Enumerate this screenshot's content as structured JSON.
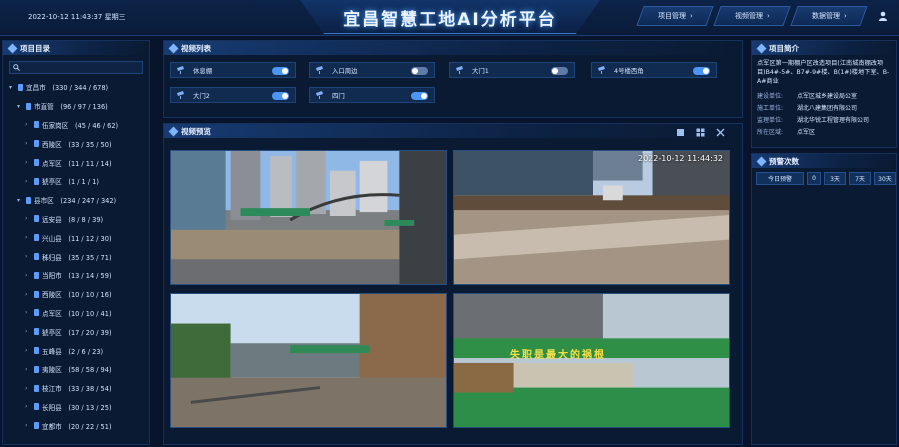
{
  "header": {
    "datetime": "2022-10-12 11:43:37 星期三",
    "title": "宜昌智慧工地AI分析平台",
    "nav": [
      "项目管理",
      "视频管理",
      "数据管理"
    ]
  },
  "left_panel": {
    "title": "项目目录",
    "tree": [
      {
        "label": "宜昌市　(330 / 344 / 678)",
        "level": 0,
        "arrow": "▾"
      },
      {
        "label": "市直管　(96 / 97 / 136)",
        "level": 1,
        "arrow": "▾"
      },
      {
        "label": "伍家岗区　(45 / 46 / 62)",
        "level": 2,
        "arrow": "›"
      },
      {
        "label": "西陵区　(33 / 35 / 50)",
        "level": 2,
        "arrow": "›"
      },
      {
        "label": "点军区　(11 / 11 / 14)",
        "level": 2,
        "arrow": "›"
      },
      {
        "label": "猇亭区　(1 / 1 / 1)",
        "level": 2,
        "arrow": "›"
      },
      {
        "label": "县市区　(234 / 247 / 342)",
        "level": 1,
        "arrow": "▾"
      },
      {
        "label": "远安县　(8 / 8 / 39)",
        "level": 2,
        "arrow": "›"
      },
      {
        "label": "兴山县　(11 / 12 / 30)",
        "level": 2,
        "arrow": "›"
      },
      {
        "label": "秭归县　(35 / 35 / 71)",
        "level": 2,
        "arrow": "›"
      },
      {
        "label": "当阳市　(13 / 14 / 59)",
        "level": 2,
        "arrow": "›"
      },
      {
        "label": "西陵区　(10 / 10 / 16)",
        "level": 2,
        "arrow": "›"
      },
      {
        "label": "点军区　(10 / 10 / 41)",
        "level": 2,
        "arrow": "›"
      },
      {
        "label": "猇亭区　(17 / 20 / 39)",
        "level": 2,
        "arrow": "›"
      },
      {
        "label": "五峰县　(2 / 6 / 23)",
        "level": 2,
        "arrow": "›"
      },
      {
        "label": "夷陵区　(58 / 58 / 94)",
        "level": 2,
        "arrow": "›"
      },
      {
        "label": "枝江市　(33 / 38 / 54)",
        "level": 2,
        "arrow": "›"
      },
      {
        "label": "长阳县　(30 / 13 / 25)",
        "level": 2,
        "arrow": "›"
      },
      {
        "label": "宜都市　(20 / 22 / 51)",
        "level": 2,
        "arrow": "›"
      }
    ]
  },
  "video_list": {
    "title": "视频列表",
    "cameras": [
      {
        "label": "休息棚",
        "on": true
      },
      {
        "label": "入口周边",
        "on": false
      },
      {
        "label": "大门1",
        "on": false
      },
      {
        "label": "4号楼西角",
        "on": true
      },
      {
        "label": "大门2",
        "on": true
      },
      {
        "label": "四门",
        "on": true
      }
    ]
  },
  "video_preview": {
    "title": "视频预览",
    "timestamp": "2022-10-12 11:44:32",
    "banner_text": "安全第一 优质施工",
    "sign_text": "失职是最大的祸根"
  },
  "project": {
    "title": "项目简介",
    "description": "点军区第一期棚户区改造项目(江南城南棚改项目)B4#-5#、B7#-9#楼、B(1#)楼地下室、B-A#商业",
    "rows": [
      {
        "k": "建设单位:",
        "v": "点军区城乡建设局公室"
      },
      {
        "k": "施工单位:",
        "v": "湖北八建集团有限公司"
      },
      {
        "k": "监理单位:",
        "v": "湖北华锐工程管理有限公司"
      },
      {
        "k": "所在区域:",
        "v": "点军区"
      }
    ]
  },
  "alarms": {
    "title": "预警次数",
    "tabs": [
      "今日预警",
      "0",
      "3天",
      "7天",
      "30天"
    ]
  },
  "colors": {
    "accent": "#4d95f5",
    "bg": "#07142b"
  }
}
